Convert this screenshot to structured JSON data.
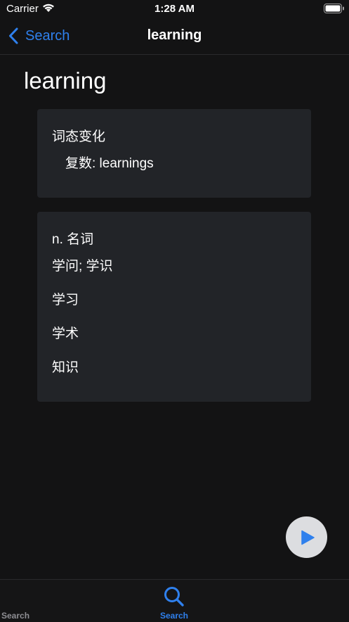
{
  "status_bar": {
    "carrier": "Carrier",
    "time": "1:28 AM"
  },
  "nav": {
    "back_label": "Search",
    "title": "learning"
  },
  "word": {
    "title": "learning"
  },
  "forms_card": {
    "heading": "词态变化",
    "form_row": "复数: learnings"
  },
  "definitions_card": {
    "part_of_speech": "n. 名词",
    "items": [
      "学问; 学识",
      "学习",
      "学术",
      "知识"
    ]
  },
  "tab_bar": {
    "items": [
      {
        "label": "Search",
        "icon": "search-icon"
      },
      {
        "label": "Search",
        "icon": "search-icon",
        "selected": true
      }
    ]
  },
  "colors": {
    "accent": "#2f80ed",
    "background": "#131314",
    "card": "#222428",
    "play_button": "#dcdde0"
  }
}
